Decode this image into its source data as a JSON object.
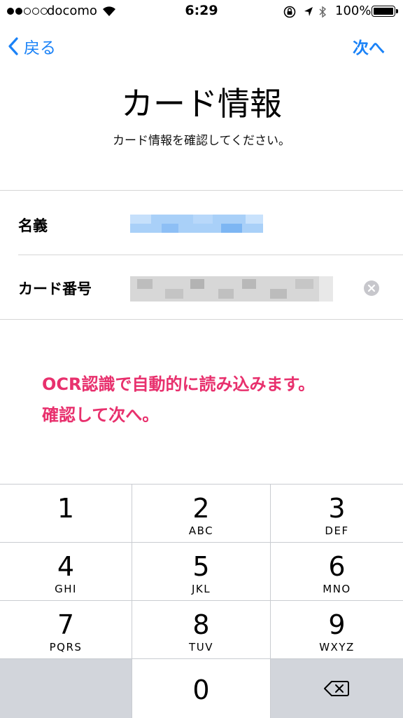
{
  "status_bar": {
    "carrier": "docomo",
    "time": "6:29",
    "battery_percent": "100%",
    "signal_bars": 2,
    "battery_level": 1.0
  },
  "nav": {
    "back_label": "戻る",
    "next_label": "次へ",
    "accent_color": "#1a82f7"
  },
  "page": {
    "title": "カード情報",
    "subtitle": "カード情報を確認してください。"
  },
  "form": {
    "name_label": "名義",
    "card_number_label": "カード番号"
  },
  "annotation": {
    "line1": "OCR認識で自動的に読み込みます。",
    "line2": "確認して次へ。",
    "color": "#e8306d"
  },
  "keypad": {
    "keys": [
      {
        "number": "1",
        "letters": ""
      },
      {
        "number": "2",
        "letters": "ABC"
      },
      {
        "number": "3",
        "letters": "DEF"
      },
      {
        "number": "4",
        "letters": "GHI"
      },
      {
        "number": "5",
        "letters": "JKL"
      },
      {
        "number": "6",
        "letters": "MNO"
      },
      {
        "number": "7",
        "letters": "PQRS"
      },
      {
        "number": "8",
        "letters": "TUV"
      },
      {
        "number": "9",
        "letters": "WXYZ"
      },
      {
        "number": "0",
        "letters": ""
      }
    ],
    "delete_icon": "backspace-icon"
  }
}
